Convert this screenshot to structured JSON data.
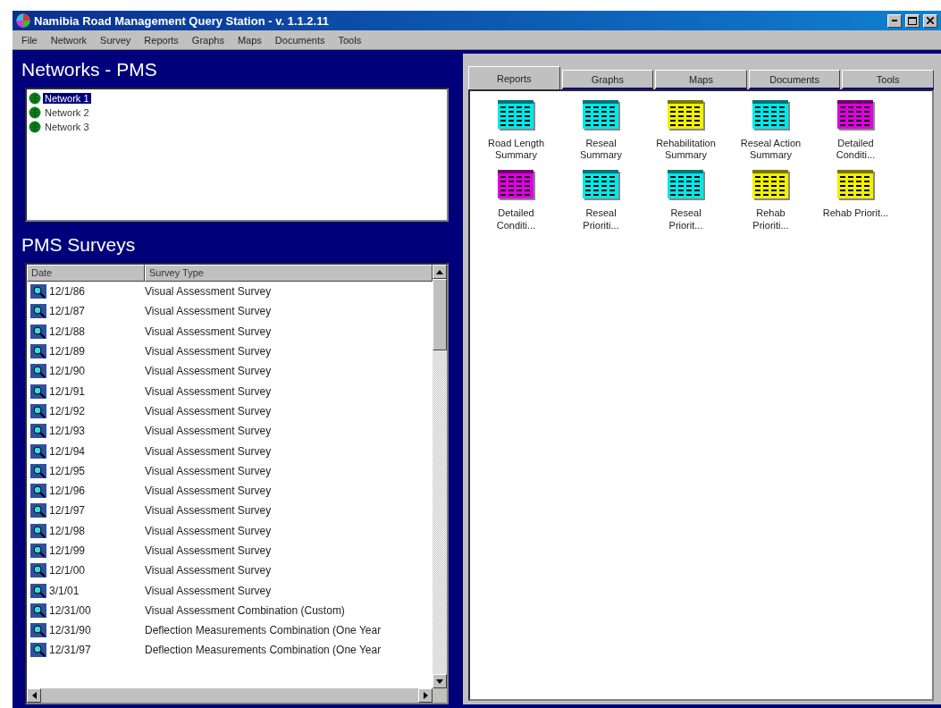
{
  "window": {
    "title": "Namibia Road Management Query Station - v. 1.1.2.11"
  },
  "menu": [
    "File",
    "Network",
    "Survey",
    "Reports",
    "Graphs",
    "Maps",
    "Documents",
    "Tools"
  ],
  "networks": {
    "title": "Networks - PMS",
    "items": [
      {
        "label": "Network 1",
        "selected": true
      },
      {
        "label": "Network 2",
        "selected": false
      },
      {
        "label": "Network 3",
        "selected": false
      }
    ]
  },
  "surveys": {
    "title": "PMS Surveys",
    "columns": [
      "Date",
      "Survey Type"
    ],
    "rows": [
      {
        "date": "12/1/86",
        "type": "Visual Assessment Survey"
      },
      {
        "date": "12/1/87",
        "type": "Visual Assessment Survey"
      },
      {
        "date": "12/1/88",
        "type": "Visual Assessment Survey"
      },
      {
        "date": "12/1/89",
        "type": "Visual Assessment Survey"
      },
      {
        "date": "12/1/90",
        "type": "Visual Assessment Survey"
      },
      {
        "date": "12/1/91",
        "type": "Visual Assessment Survey"
      },
      {
        "date": "12/1/92",
        "type": "Visual Assessment Survey"
      },
      {
        "date": "12/1/93",
        "type": "Visual Assessment Survey"
      },
      {
        "date": "12/1/94",
        "type": "Visual Assessment Survey"
      },
      {
        "date": "12/1/95",
        "type": "Visual Assessment Survey"
      },
      {
        "date": "12/1/96",
        "type": "Visual Assessment Survey"
      },
      {
        "date": "12/1/97",
        "type": "Visual Assessment Survey"
      },
      {
        "date": "12/1/98",
        "type": "Visual Assessment Survey"
      },
      {
        "date": "12/1/99",
        "type": "Visual Assessment Survey"
      },
      {
        "date": "12/1/00",
        "type": "Visual Assessment Survey"
      },
      {
        "date": "3/1/01",
        "type": "Visual Assessment Survey"
      },
      {
        "date": "12/31/00",
        "type": "Visual Assessment Combination (Custom)"
      },
      {
        "date": "12/31/90",
        "type": "Deflection Measurements Combination (One Year"
      },
      {
        "date": "12/31/97",
        "type": "Deflection Measurements Combination (One Year"
      }
    ]
  },
  "tabs": [
    {
      "label": "Reports",
      "selected": true
    },
    {
      "label": "Graphs",
      "selected": false
    },
    {
      "label": "Maps",
      "selected": false
    },
    {
      "label": "Documents",
      "selected": false
    },
    {
      "label": "Tools",
      "selected": false
    }
  ],
  "reports": [
    {
      "label": "Road Length Summary",
      "color": "#00e8e8"
    },
    {
      "label": "Reseal Summary",
      "color": "#00e8e8"
    },
    {
      "label": "Rehabilitation Summary",
      "color": "#f0f000"
    },
    {
      "label": "Reseal Action Summary",
      "color": "#00e8e8"
    },
    {
      "label": "Detailed Conditi...",
      "color": "#e000e0"
    },
    {
      "label": "Detailed Conditi...",
      "color": "#e000e0"
    },
    {
      "label": "Reseal Prioriti...",
      "color": "#00e8e8"
    },
    {
      "label": "Reseal Priorit...",
      "color": "#00e8e8"
    },
    {
      "label": "Rehab Prioriti...",
      "color": "#f0f000"
    },
    {
      "label": "Rehab Priorit...",
      "color": "#f0f000"
    }
  ]
}
